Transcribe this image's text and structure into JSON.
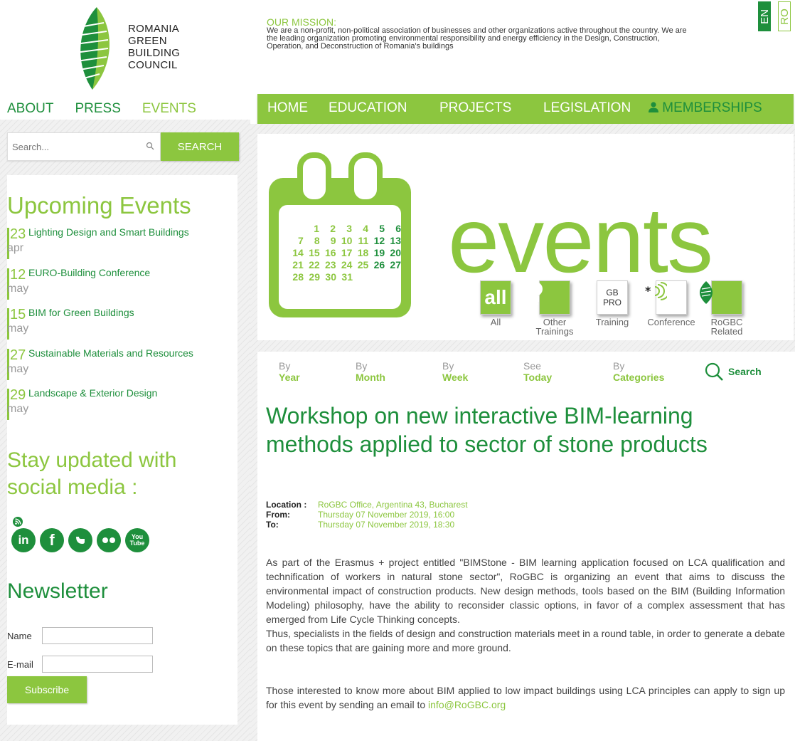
{
  "logo": {
    "lines": [
      "ROMANIA",
      "GREEN",
      "BUILDING",
      "COUNCIL"
    ]
  },
  "left_nav": [
    {
      "label": "ABOUT",
      "active": false
    },
    {
      "label": "PRESS",
      "active": false
    },
    {
      "label": "EVENTS",
      "active": true
    }
  ],
  "search": {
    "placeholder": "Search...",
    "button": "SEARCH"
  },
  "upcoming": {
    "title": "Upcoming Events",
    "items": [
      {
        "day": "23",
        "month": "apr",
        "title": "Lighting Design and Smart Buildings"
      },
      {
        "day": "12",
        "month": "may",
        "title": "EURO-Building Conference"
      },
      {
        "day": "15",
        "month": "may",
        "title": "BIM for Green Buildings"
      },
      {
        "day": "27",
        "month": "may",
        "title": "Sustainable Materials and Resources"
      },
      {
        "day": "29",
        "month": "may",
        "title": "Landscape & Exterior Design"
      }
    ]
  },
  "social": {
    "title": "Stay updated with social media :",
    "icons": [
      "rss-icon",
      "linkedin-icon",
      "facebook-icon",
      "twitter-icon",
      "flickr-icon",
      "youtube-icon"
    ],
    "labels": {
      "linkedin": "in",
      "facebook": "f",
      "youtube": "You Tube"
    }
  },
  "newsletter": {
    "title": "Newsletter",
    "name_label": "Name",
    "email_label": "E-mail",
    "name_value": "",
    "email_value": "",
    "subscribe": "Subscribe"
  },
  "mission": {
    "title": "OUR MISSION:",
    "text": "We are a non-profit, non-political association of businesses and other organizations active throughout the country. We are the leading organization promoting environmental responsibility and energy efficiency in the Design, Construction, Operation, and Deconstruction of Romania's buildings"
  },
  "lang": {
    "en": "EN",
    "ro": "RO"
  },
  "main_nav": {
    "home": "HOME",
    "education": "EDUCATION",
    "projects": "PROJECTS",
    "legislation": "LEGISLATION",
    "memberships": "MEMBERSHIPS"
  },
  "banner": {
    "word": "events",
    "calendar_rows": [
      [
        "1",
        "2",
        "3",
        "4",
        "5",
        "6"
      ],
      [
        "7",
        "8",
        "9",
        "10",
        "11",
        "12",
        "13"
      ],
      [
        "14",
        "15",
        "16",
        "17",
        "18",
        "19",
        "20"
      ],
      [
        "21",
        "22",
        "23",
        "24",
        "25",
        "26",
        "27"
      ],
      [
        "28",
        "29",
        "30",
        "31"
      ]
    ],
    "categories": [
      {
        "label": "All",
        "icon": "all-icon",
        "icon_text": "all"
      },
      {
        "label": "Other Trainings",
        "icon": "lightbulb-icon",
        "icon_text": ""
      },
      {
        "label": "Training",
        "icon": "gbpro-icon",
        "icon_text": "GB PRO"
      },
      {
        "label": "Conference",
        "icon": "conference-icon",
        "icon_text": ""
      },
      {
        "label": "RoGBC Related",
        "icon": "rogbc-icon",
        "icon_text": ""
      }
    ]
  },
  "view_nav": [
    {
      "small": "By",
      "big": "Year"
    },
    {
      "small": "By",
      "big": "Month"
    },
    {
      "small": "By",
      "big": "Week"
    },
    {
      "small": "See",
      "big": "Today"
    },
    {
      "small": "By",
      "big": "Categories"
    }
  ],
  "view_search": "Search",
  "article": {
    "title": "Workshop on new interactive BIM-learning methods applied to sector of stone products",
    "meta": [
      {
        "key": "Location :",
        "value": "RoGBC Office, Argentina 43, Bucharest"
      },
      {
        "key": "From:",
        "value": "Thursday 07 November 2019, 16:00"
      },
      {
        "key": "To:",
        "value": "Thursday 07 November 2019, 18:30"
      }
    ],
    "p1": "As part of the Erasmus + project entitled \"BIMStone - BIM learning application focused on LCA qualification and technification of workers in natural stone sector\", RoGBC is organizing an event that aims to discuss the environmental impact of construction products. New design methods, tools based on the BIM (Building Information Modeling) philosophy, have the ability to reconsider classic options, in favor of a complex assessment that has emerged from Life Cycle Thinking concepts.",
    "p2": "Thus, specialists in the fields of design and construction materials meet in a round table, in order to generate a debate on these topics that are gaining more and more ground.",
    "p3": "Those interested to know more about BIM applied to low impact buildings using LCA principles can apply to sign up for this event by sending an email to ",
    "email": "info@RoGBC.org"
  },
  "colors": {
    "green_light": "#8cc63f",
    "green_dark": "#1e8f3c"
  }
}
